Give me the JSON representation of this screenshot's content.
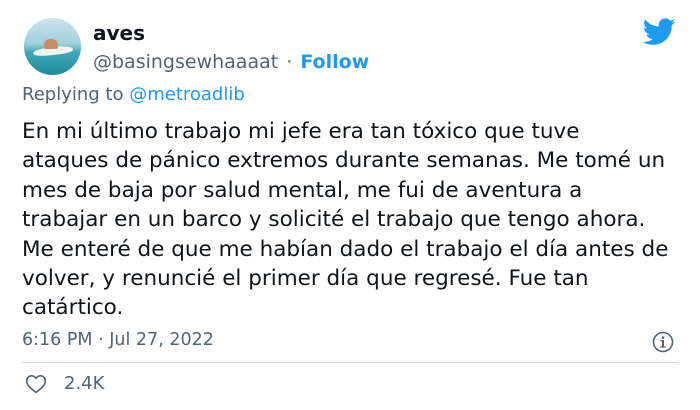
{
  "author": {
    "display_name": "aves",
    "handle": "@basingsewhaaaat",
    "separator": "·",
    "follow_label": "Follow",
    "avatar": "avatar-photo"
  },
  "reply": {
    "prefix": "Replying to",
    "mention": "@metroadlib"
  },
  "tweet": {
    "text": "En mi último trabajo mi jefe era tan tóxico que tuve ataques de pánico extremos durante semanas. Me tomé un mes de baja por salud mental, me fui de aventura a trabajar en un barco y solicité el trabajo que tengo ahora. Me enteré de que me habían dado el trabajo el día antes de volver, y renuncié el primer día que regresé. Fue tan catártico.",
    "time": "6:16 PM",
    "separator": "·",
    "date": "Jul 27, 2022"
  },
  "engagement": {
    "likes": "2.4K"
  },
  "icons": {
    "brand": "twitter-bird-icon",
    "info": "info-icon",
    "like": "heart-icon"
  },
  "colors": {
    "accent": "#1d9bf0",
    "secondary_text": "#536471",
    "primary_text": "#0f1419",
    "divider": "#cfd9de"
  }
}
